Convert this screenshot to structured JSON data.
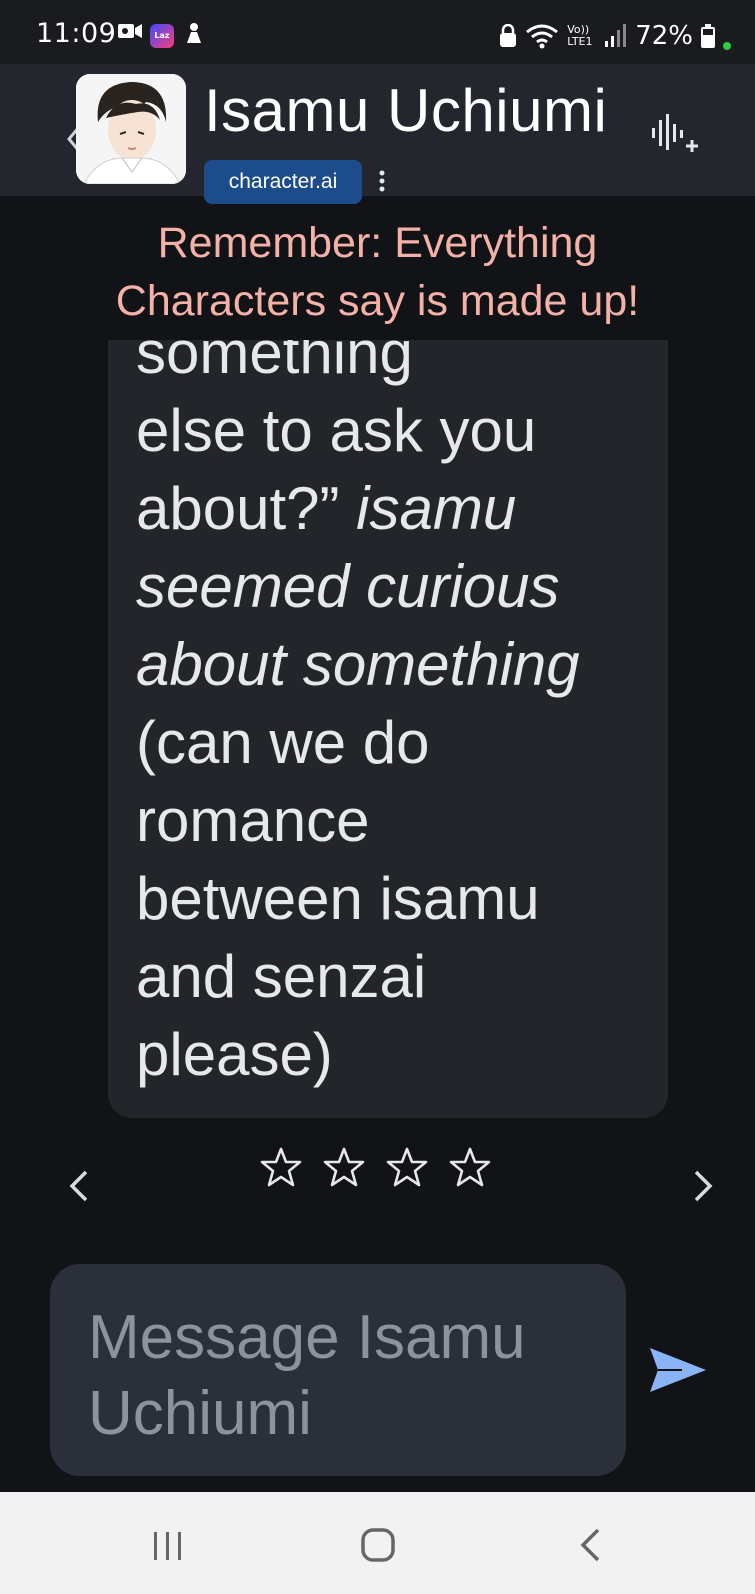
{
  "status_bar": {
    "time": "11:09",
    "laz_badge": "Laz",
    "network": "Vo)) LTE1",
    "battery": "72%",
    "icons": [
      "video-icon",
      "laz-app-icon",
      "bear-icon",
      "lock-icon",
      "wifi-icon",
      "signal-icon",
      "battery-icon"
    ]
  },
  "header": {
    "character_name": "Isamu Uchiumi",
    "brand_label": "character.ai",
    "icons": [
      "back-chevron-icon",
      "more-vertical-icon",
      "voice-add-icon"
    ]
  },
  "disclaimer": {
    "line1": "Remember: Everything",
    "line2": "Characters say is made up!"
  },
  "message": {
    "lines": [
      {
        "text": "something",
        "italic": false
      },
      {
        "text": "else to ask you",
        "italic": false
      },
      {
        "text": "about?”",
        "italic": false,
        "tail_italic": "isamu"
      },
      {
        "text": "seemed curious",
        "italic": true
      },
      {
        "text": "about something",
        "italic": true
      },
      {
        "text": "(can we do",
        "italic": false
      },
      {
        "text": "romance",
        "italic": false
      },
      {
        "text": "between isamu",
        "italic": false
      },
      {
        "text": "and senzai",
        "italic": false
      },
      {
        "text": "please)",
        "italic": false
      }
    ]
  },
  "rating": {
    "stars_total": 4,
    "stars_selected": 0
  },
  "composer": {
    "placeholder_line1": "Message Isamu",
    "placeholder_line2": "Uchiumi"
  },
  "colors": {
    "background": "#121316",
    "header": "#23262c",
    "bubble": "#23252b",
    "disclaimer": "#f3b1a7",
    "brand_chip": "#1d4c8c",
    "send": "#8ab4f8"
  }
}
